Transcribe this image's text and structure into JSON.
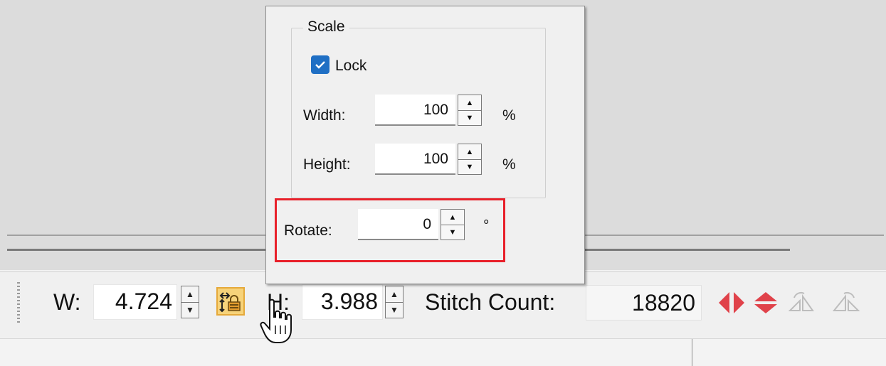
{
  "popup": {
    "scale_group_title": "Scale",
    "lock_label": "Lock",
    "lock_checked": true,
    "width_label": "Width:",
    "width_value": "100",
    "width_unit": "%",
    "height_label": "Height:",
    "height_value": "100",
    "height_unit": "%",
    "rotate_label": "Rotate:",
    "rotate_value": "0",
    "rotate_unit": "°"
  },
  "toolbar": {
    "w_label": "W:",
    "w_value": "4.724",
    "h_label": "H:",
    "h_value": "3.988",
    "stitch_label": "Stitch Count:",
    "stitch_value": "18820"
  },
  "colors": {
    "highlight": "#e8202a",
    "checkbox": "#1f6fc4",
    "lock_button": "#f7d37a",
    "mirror_icons": "#e0424a"
  },
  "icons": [
    "lock-aspect-icon",
    "mirror-horizontal-icon",
    "mirror-vertical-icon",
    "rotate-left-icon",
    "rotate-right-icon",
    "hand-cursor-icon"
  ]
}
